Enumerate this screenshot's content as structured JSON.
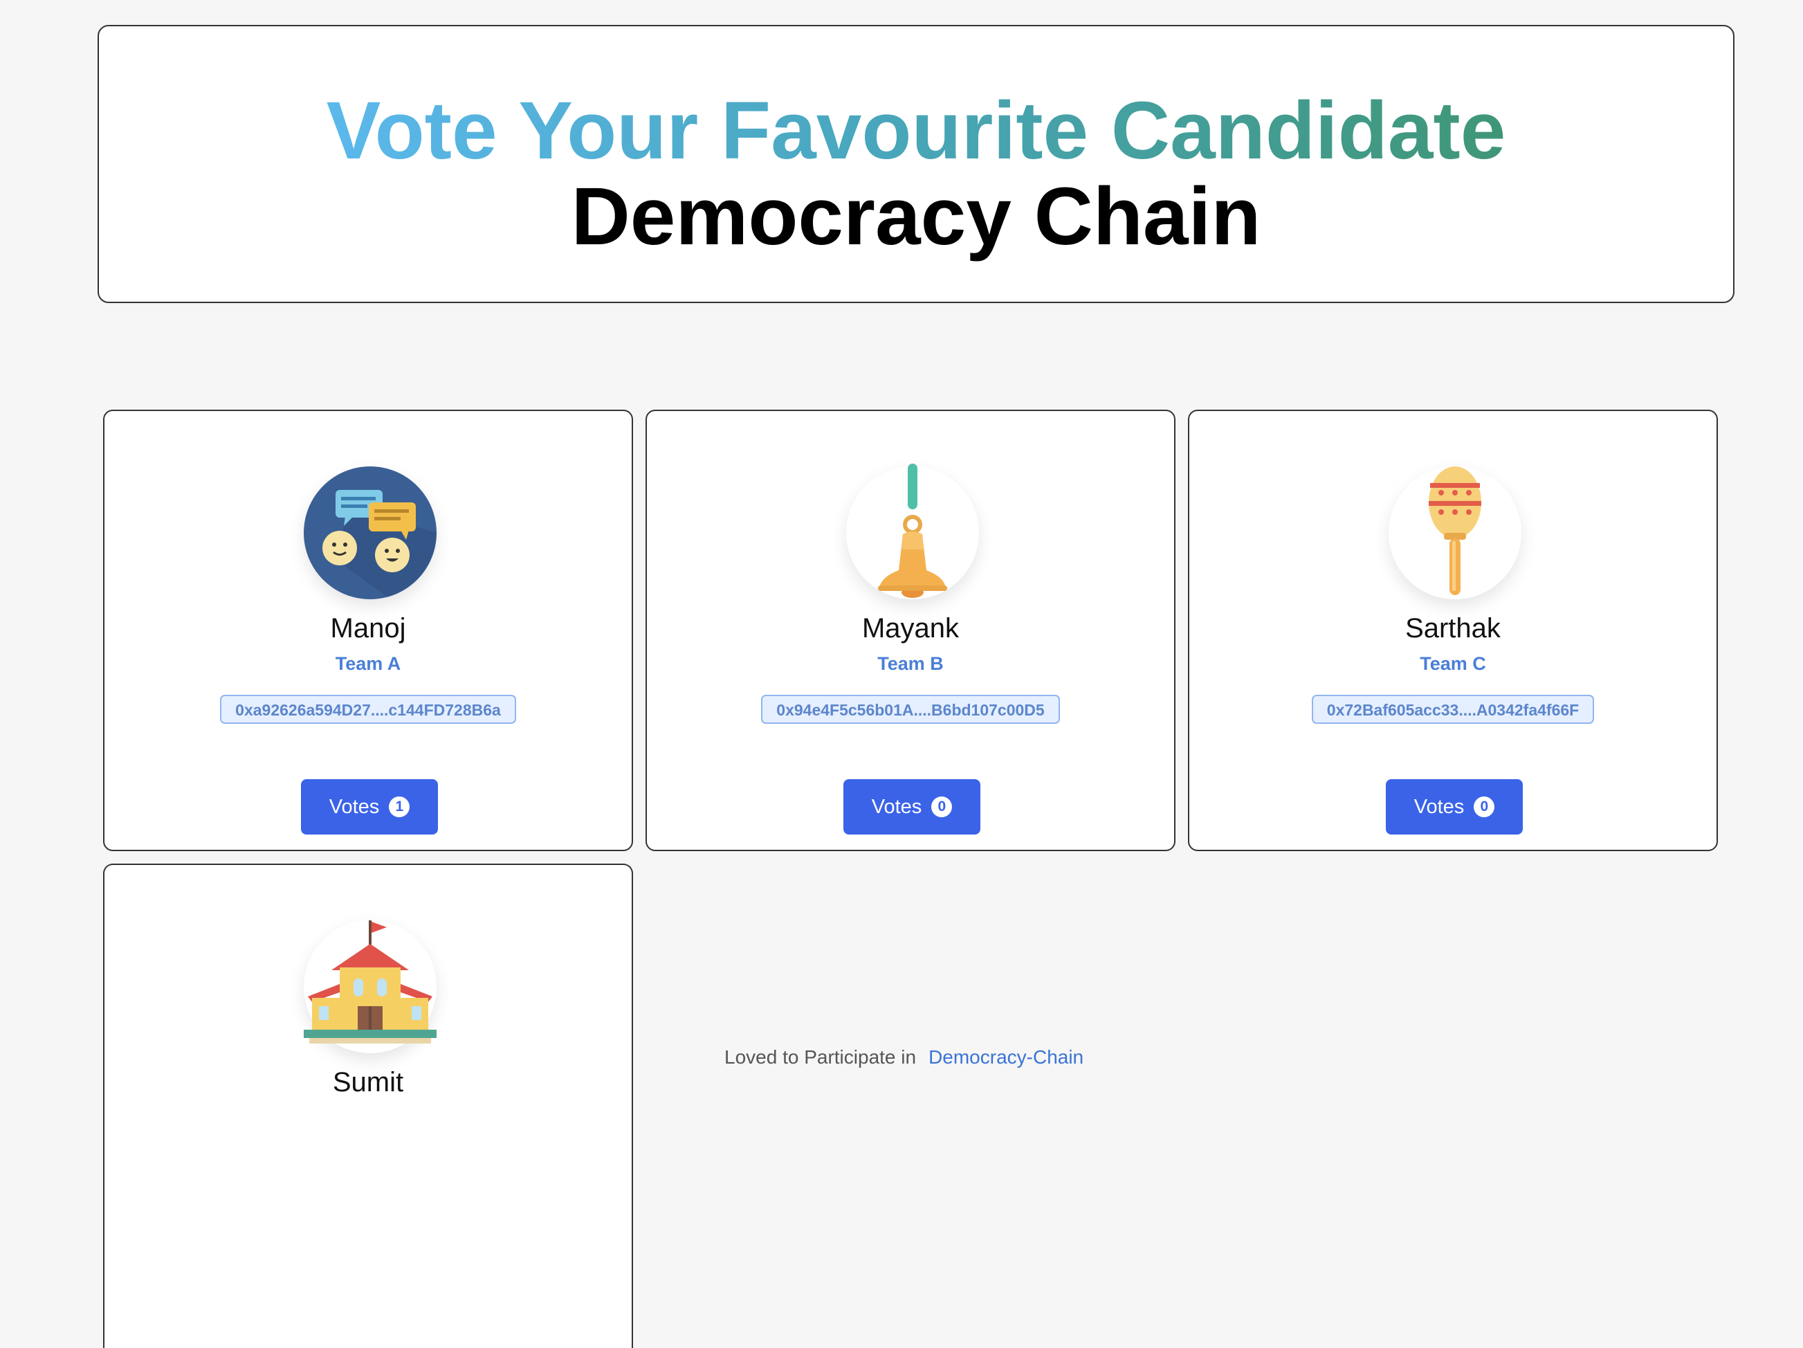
{
  "header": {
    "title": "Vote Your Favourite Candidate",
    "subtitle": "Democracy Chain"
  },
  "candidates": [
    {
      "name": "Manoj",
      "team": "Team A",
      "address": "0xa92626a594D27....c144FD728B6a",
      "votes_label": "Votes",
      "votes": "1",
      "icon": "chat-people-icon"
    },
    {
      "name": "Mayank",
      "team": "Team B",
      "address": "0x94e4F5c56b01A....B6bd107c00D5",
      "votes_label": "Votes",
      "votes": "0",
      "icon": "bell-icon"
    },
    {
      "name": "Sarthak",
      "team": "Team C",
      "address": "0x72Baf605acc33....A0342fa4f66F",
      "votes_label": "Votes",
      "votes": "0",
      "icon": "maraca-icon"
    },
    {
      "name": "Sumit",
      "icon": "school-building-icon"
    }
  ],
  "footer": {
    "text": "Loved to Participate in",
    "link": "Democracy-Chain"
  },
  "colors": {
    "accent": "#3b63e8",
    "team_text": "#4a7fd8",
    "title_gradient_start": "#5bb8ec",
    "title_gradient_end": "#3f9676"
  }
}
